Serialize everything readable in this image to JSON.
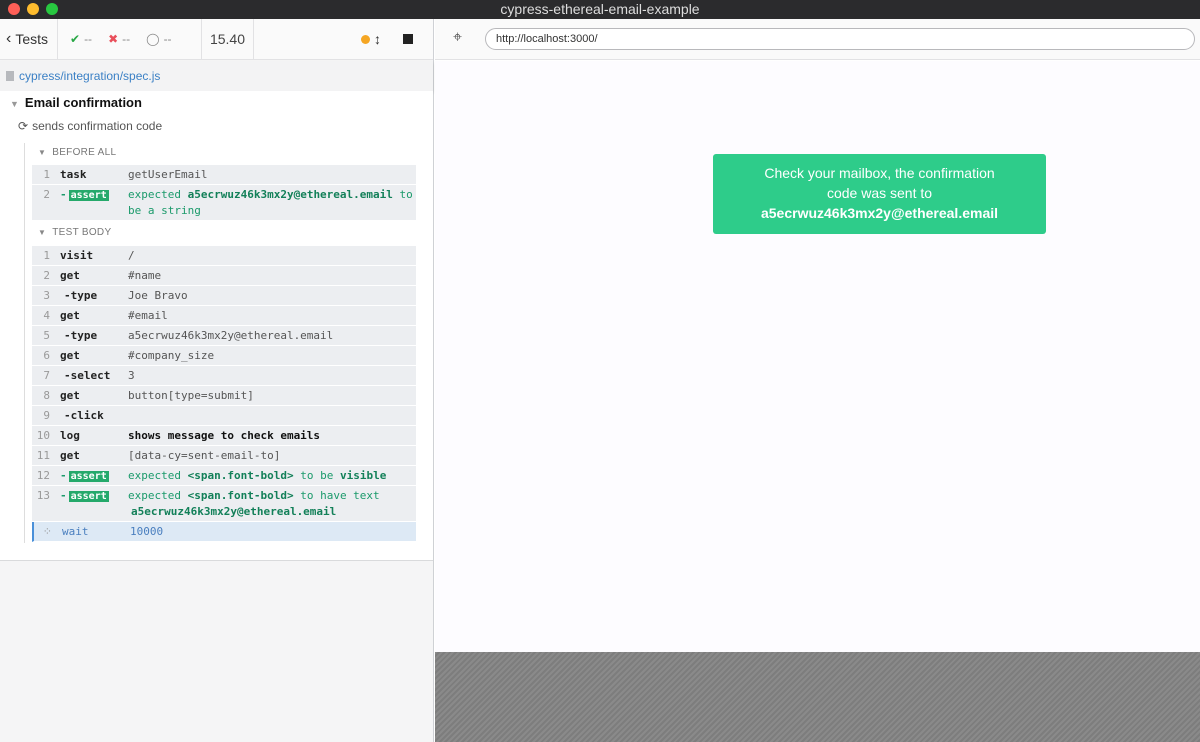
{
  "window": {
    "title": "cypress-ethereal-email-example"
  },
  "header": {
    "tests_label": "Tests",
    "passed": "--",
    "failed": "--",
    "pending": "--",
    "duration": "15.40"
  },
  "spec": {
    "path": "cypress/integration/spec.js"
  },
  "suite": {
    "title": "Email confirmation"
  },
  "test": {
    "title": "sends confirmation code"
  },
  "hooks": {
    "before_all": "BEFORE ALL",
    "test_body": "TEST BODY"
  },
  "before_all_commands": [
    {
      "num": "1",
      "name": "task",
      "message": "getUserEmail"
    },
    {
      "num": "2",
      "name": "assert",
      "message_prefix": "expected",
      "message_bold": "a5ecrwuz46k3mx2y@ethereal.email",
      "message_suffix": "to",
      "message_line2": "be a string"
    }
  ],
  "body_commands": [
    {
      "num": "1",
      "name": "visit",
      "message": "/"
    },
    {
      "num": "2",
      "name": "get",
      "message": "#name"
    },
    {
      "num": "3",
      "name": "-type",
      "message": "Joe Bravo"
    },
    {
      "num": "4",
      "name": "get",
      "message": "#email"
    },
    {
      "num": "5",
      "name": "-type",
      "message": "a5ecrwuz46k3mx2y@ethereal.email"
    },
    {
      "num": "6",
      "name": "get",
      "message": "#company_size"
    },
    {
      "num": "7",
      "name": "-select",
      "message": "3"
    },
    {
      "num": "8",
      "name": "get",
      "message": "button[type=submit]"
    },
    {
      "num": "9",
      "name": "-click",
      "message": ""
    },
    {
      "num": "10",
      "name": "log",
      "message": "shows message to check emails"
    },
    {
      "num": "11",
      "name": "get",
      "message": "[data-cy=sent-email-to]"
    },
    {
      "num": "12",
      "name": "assert",
      "message_prefix": "expected",
      "message_bold": "<span.font-bold>",
      "message_middle": "to be",
      "message_bold2": "visible"
    },
    {
      "num": "13",
      "name": "assert",
      "message_prefix": "expected",
      "message_bold": "<span.font-bold>",
      "message_middle": "to have text",
      "message_line2": "a5ecrwuz46k3mx2y@ethereal.email"
    },
    {
      "num": "",
      "name": "wait",
      "message": "10000"
    }
  ],
  "browser": {
    "url": "http://localhost:3000/"
  },
  "app_content": {
    "message_line1": "Check your mailbox, the confirmation",
    "message_line2": "code was sent to",
    "email": "a5ecrwuz46k3mx2y@ethereal.email"
  },
  "colors": {
    "success": "#2ecc8a",
    "assert_badge": "#25a96b",
    "link": "#3b80c5"
  },
  "icons": [
    "chevron-left-icon",
    "check-icon",
    "x-icon",
    "circle-icon",
    "running-dot-icon",
    "scroll-arrows-icon",
    "stop-icon",
    "file-icon",
    "caret-down-icon",
    "spinner-icon",
    "crosshair-icon"
  ]
}
